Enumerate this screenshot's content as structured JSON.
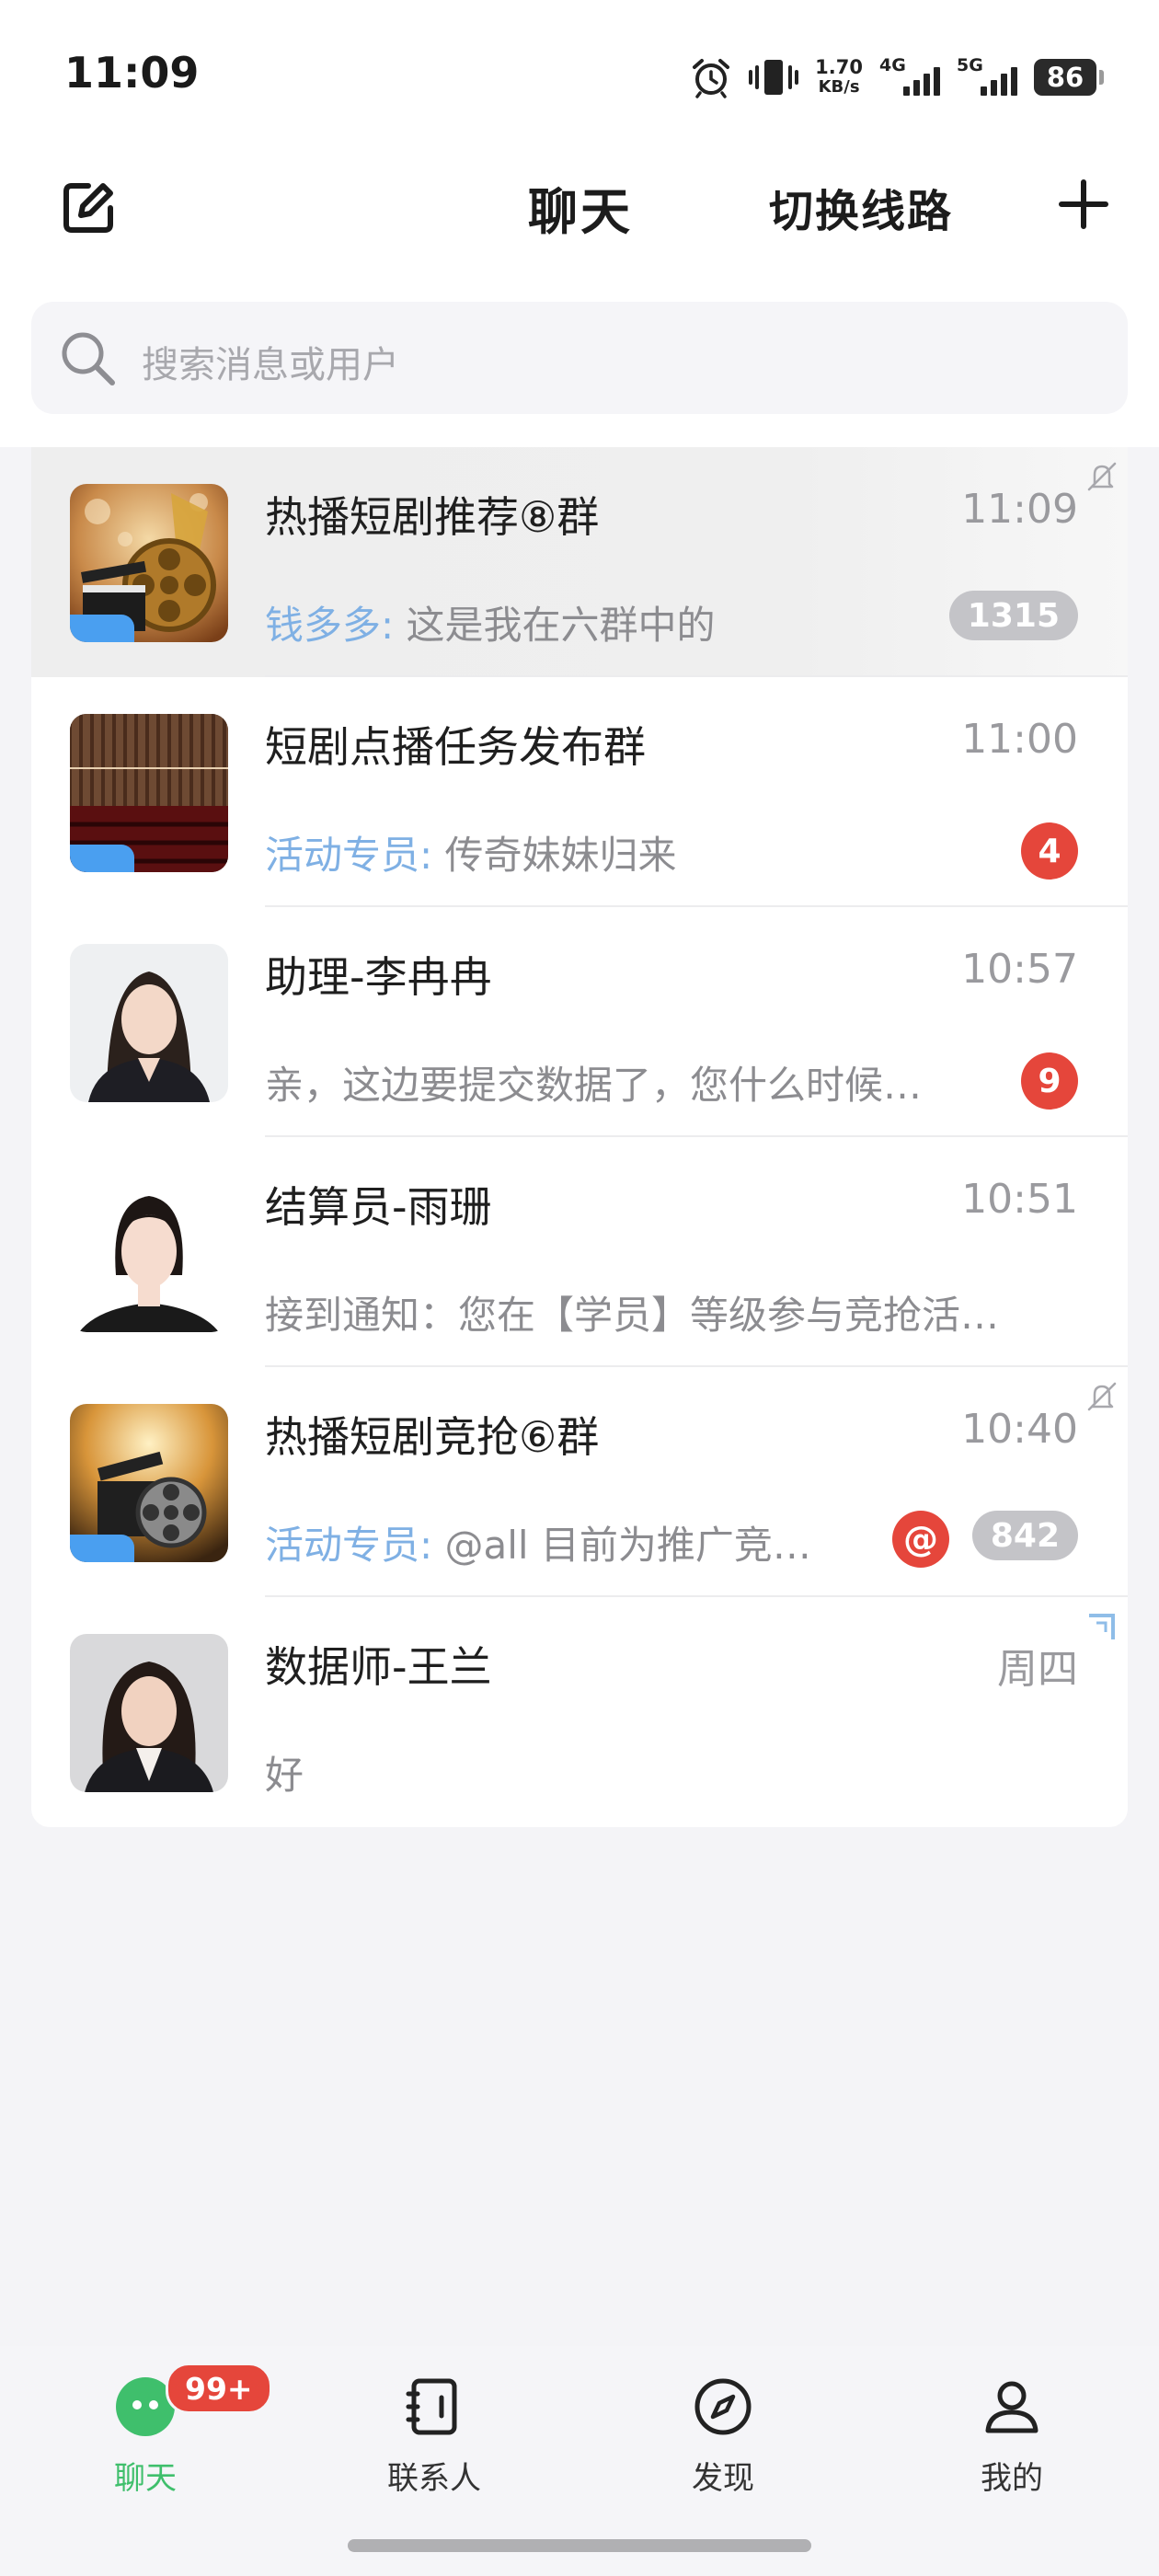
{
  "status_bar": {
    "time": "11:09",
    "net_speed_value": "1.70",
    "net_speed_unit": "KB/s",
    "signal_1_label": "4G",
    "signal_2_label": "5G",
    "battery_level": "86"
  },
  "header": {
    "title": "聊天",
    "switch_route_label": "切换线路",
    "edit_icon": "compose-icon",
    "add_icon": "plus-icon"
  },
  "search": {
    "placeholder": "搜索消息或用户"
  },
  "chats": [
    {
      "name": "热播短剧推荐⑧群",
      "time": "11:09",
      "sender": "钱多多:",
      "message": " 这是我在六群中的",
      "unread": "1315",
      "muted": true,
      "pinned": true,
      "group": true
    },
    {
      "name": "短剧点播任务发布群",
      "time": "11:00",
      "sender": "活动专员:",
      "message": " 传奇妹妹归来",
      "unread": "4",
      "group": true
    },
    {
      "name": "助理-李冉冉",
      "time": "10:57",
      "sender": "",
      "message": "亲，这边要提交数据了，您什么时候…",
      "unread": "9"
    },
    {
      "name": "结算员-雨珊",
      "time": "10:51",
      "sender": "",
      "message": "接到通知：您在【学员】等级参与竞抢活…",
      "unread": ""
    },
    {
      "name": "热播短剧竞抢⑥群",
      "time": "10:40",
      "sender": "活动专员:",
      "message": " @all  目前为推广竞…",
      "mention": "@",
      "unread": "842",
      "muted": true,
      "group": true
    },
    {
      "name": "数据师-王兰",
      "time": "周四",
      "sender": "",
      "message": "好",
      "unread": ""
    }
  ],
  "tab_bar": {
    "tabs": [
      {
        "label": "聊天",
        "icon": "chat-bubble-icon",
        "active": true
      },
      {
        "label": "联系人",
        "icon": "contacts-book-icon"
      },
      {
        "label": "发现",
        "icon": "compass-icon"
      },
      {
        "label": "我的",
        "icon": "person-icon"
      }
    ],
    "chat_badge": "99+"
  },
  "colors": {
    "accent_green": "#3fbf6c",
    "badge_red": "#e5463b",
    "sender_blue": "#7fb0e4",
    "muted_badge_gray": "#c4c4c8"
  }
}
